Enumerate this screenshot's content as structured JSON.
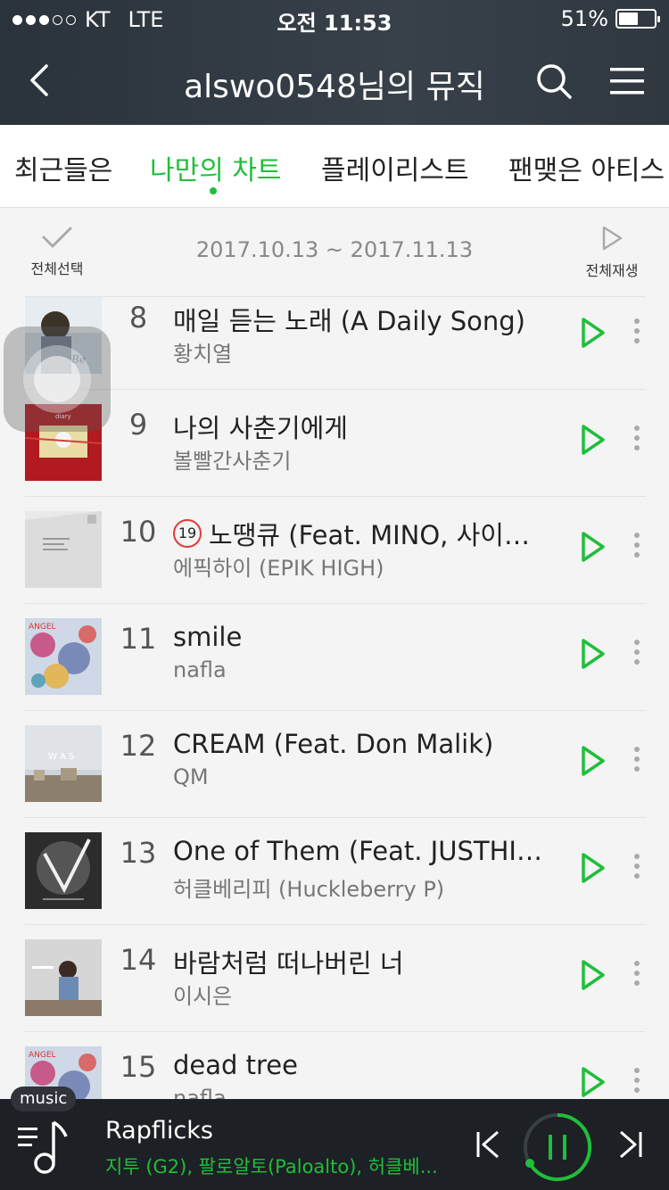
{
  "status": {
    "carrier": "KT",
    "network": "LTE",
    "time": "오전 11:53",
    "battery": "51%",
    "battery_level": 0.51
  },
  "header": {
    "title": "alswo0548님의 뮤직"
  },
  "tabs": [
    {
      "label": "최근들은"
    },
    {
      "label": "나만의 차트"
    },
    {
      "label": "플레이리스트"
    },
    {
      "label": "팬맺은 아티스"
    }
  ],
  "toolbar": {
    "select_all": "전체선택",
    "date_range": "2017.10.13 ~ 2017.11.13",
    "play_all": "전체재생"
  },
  "songs": [
    {
      "rank": "8",
      "title": "매일 듣는 노래 (A Daily Song)",
      "artist": "황치열",
      "explicit": false
    },
    {
      "rank": "9",
      "title": "나의 사춘기에게",
      "artist": "볼빨간사춘기",
      "explicit": false
    },
    {
      "rank": "10",
      "title": "노땡큐 (Feat. MINO, 사이먼...",
      "artist": "에픽하이 (EPIK HIGH)",
      "explicit": true,
      "badge": "19"
    },
    {
      "rank": "11",
      "title": "smile",
      "artist": "nafla",
      "explicit": false
    },
    {
      "rank": "12",
      "title": "CREAM (Feat. Don Malik)",
      "artist": "QM",
      "explicit": false
    },
    {
      "rank": "13",
      "title": "One of Them (Feat. JUSTHIS...",
      "artist": "허클베리피 (Huckleberry P)",
      "explicit": false
    },
    {
      "rank": "14",
      "title": "바람처럼 떠나버린 너",
      "artist": "이시은",
      "explicit": false
    },
    {
      "rank": "15",
      "title": "dead tree",
      "artist": "nafla",
      "explicit": false
    }
  ],
  "player": {
    "tag": "music",
    "title": "Rapflicks",
    "artist": "지투 (G2), 팔로알토(Paloalto), 허클베...",
    "state": "playing"
  },
  "colors": {
    "accent": "#1fbe3b",
    "header_bg": "#2f373f",
    "player_bg": "#1d2024",
    "explicit": "#e23a3a"
  }
}
